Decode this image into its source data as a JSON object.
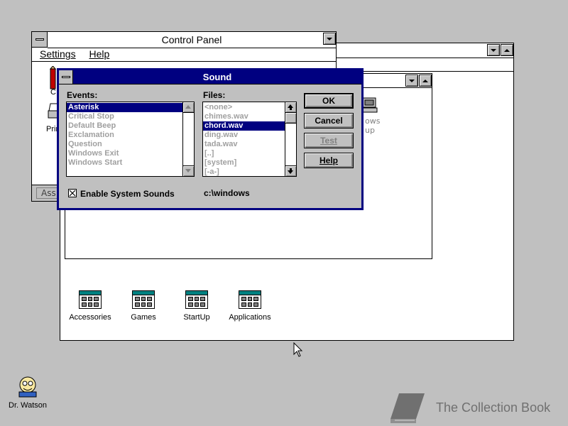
{
  "desktop": {
    "icons": [
      {
        "label": "Dr. Watson",
        "icon": "dr-watson-icon"
      }
    ],
    "watermark": {
      "text": "The Collection Book",
      "icon": "book-icon"
    }
  },
  "program_manager": {
    "group_icons": [
      {
        "label": "Accessories",
        "icon": "program-group-icon"
      },
      {
        "label": "Games",
        "icon": "program-group-icon"
      },
      {
        "label": "StartUp",
        "icon": "program-group-icon"
      },
      {
        "label": "Applications",
        "icon": "program-group-icon"
      }
    ],
    "main_group": {
      "partial_labels": [
        "ows",
        "up"
      ]
    }
  },
  "control_panel": {
    "title": "Control Panel",
    "menu": [
      {
        "label": "Settings"
      },
      {
        "label": "Help"
      }
    ],
    "partial_labels": [
      "C",
      "Prin"
    ],
    "status_text": "Ass"
  },
  "sound_dialog": {
    "title": "Sound",
    "events_label": "Events:",
    "files_label": "Files:",
    "events": [
      {
        "label": "Asterisk",
        "selected": true
      },
      {
        "label": "Critical Stop",
        "selected": false
      },
      {
        "label": "Default Beep",
        "selected": false
      },
      {
        "label": "Exclamation",
        "selected": false
      },
      {
        "label": "Question",
        "selected": false
      },
      {
        "label": "Windows Exit",
        "selected": false
      },
      {
        "label": "Windows Start",
        "selected": false
      }
    ],
    "files": [
      {
        "label": "<none>",
        "selected": false
      },
      {
        "label": "chimes.wav",
        "selected": false
      },
      {
        "label": "chord.wav",
        "selected": true
      },
      {
        "label": "ding.wav",
        "selected": false
      },
      {
        "label": "tada.wav",
        "selected": false
      },
      {
        "label": "[..]",
        "selected": false
      },
      {
        "label": "[system]",
        "selected": false
      },
      {
        "label": "[-a-]",
        "selected": false
      }
    ],
    "buttons": {
      "ok": "OK",
      "cancel": "Cancel",
      "test": "Test",
      "help": "Help"
    },
    "enable_sounds": {
      "label": "Enable System Sounds",
      "checked": true
    },
    "current_path": "c:\\windows"
  },
  "colors": {
    "desktop": "#c0c0c0",
    "active_title": "#000080",
    "selection": "#000080",
    "disabled_text": "#a0a0a0"
  }
}
